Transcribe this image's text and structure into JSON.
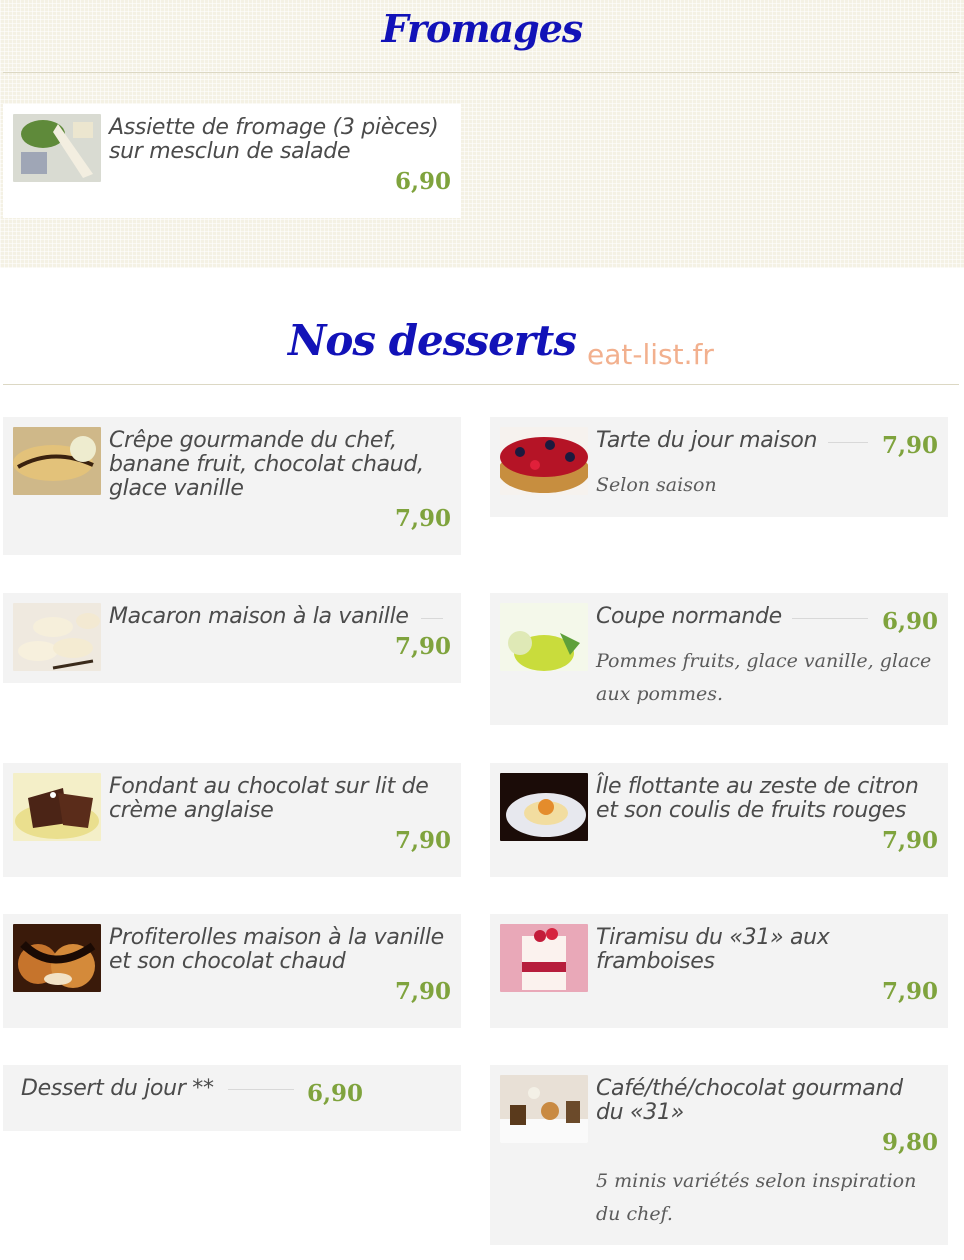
{
  "fromages": {
    "title": "Fromages",
    "items": [
      {
        "name": "Assiette de fromage (3 pièces) sur mesclun de salade",
        "price": "6,90"
      }
    ]
  },
  "desserts": {
    "title": "Nos desserts",
    "watermark": "eat-list.fr",
    "items": [
      {
        "name": "Crêpe gourmande du chef, banane fruit, chocolat chaud, glace vanille",
        "price": "7,90"
      },
      {
        "name": "Tarte du jour maison",
        "price": "7,90",
        "description": "Selon saison"
      },
      {
        "name": "Macaron maison à la vanille",
        "price": "7,90"
      },
      {
        "name": "Coupe normande",
        "price": "6,90",
        "description": "Pommes fruits, glace vanille, glace aux pommes."
      },
      {
        "name": "Fondant au chocolat sur lit de crème anglaise",
        "price": "7,90"
      },
      {
        "name": "Île flottante au zeste de citron et son coulis de fruits rouges",
        "price": "7,90"
      },
      {
        "name": "Profiterolles maison à la vanille et son chocolat chaud",
        "price": "7,90"
      },
      {
        "name": "Tiramisu du «31» aux framboises",
        "price": "7,90"
      },
      {
        "name": "Dessert du jour **",
        "price": "6,90"
      },
      {
        "name": "Café/thé/chocolat gourmand du «31»",
        "price": "9,80",
        "description": "5 minis variétés selon inspiration du chef."
      }
    ]
  }
}
